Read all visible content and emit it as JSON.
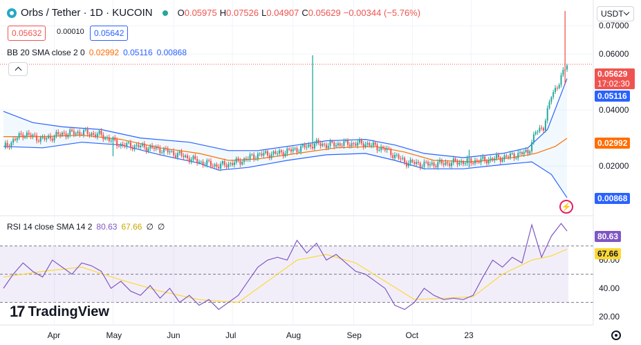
{
  "header": {
    "symbol": "Orbs / Tether · 1D · KUCOIN",
    "ohlc": {
      "o_label": "O",
      "o": "0.05975",
      "h_label": "H",
      "h": "0.07526",
      "l_label": "L",
      "l": "0.04907",
      "c_label": "C",
      "c": "0.05629",
      "change": "−0.00344 (−5.76%)"
    },
    "sell_price": "0.05632",
    "spread": "0.00010",
    "buy_price": "0.05642",
    "unit": "USDT"
  },
  "bb_legend": {
    "label": "BB 20 SMA close 2 0",
    "basis": "0.02992",
    "upper": "0.05116",
    "lower": "0.00868"
  },
  "rsi_legend": {
    "label": "RSI 14 close SMA 14 2",
    "rsi": "80.63",
    "sma": "67.66",
    "v3": "∅",
    "v4": "∅"
  },
  "price_tags": {
    "close": "0.05629",
    "countdown": "17:02:30",
    "upper": "0.05116",
    "basis": "0.02992",
    "lower": "0.00868"
  },
  "rsi_tags": {
    "rsi": "80.63",
    "sma": "67.66"
  },
  "colors": {
    "up": "#26a69a",
    "down": "#ef5350",
    "band": "#2962ff",
    "basis": "#ff6d00",
    "rsi": "#7e57c2",
    "rsi_sma": "#fdd835"
  },
  "brand": {
    "name": "TradingView"
  },
  "chart_data": [
    {
      "type": "candlestick",
      "series_name": "Orbs / Tether",
      "x_ticks": [
        "Apr",
        "May",
        "Jun",
        "Jul",
        "Aug",
        "Sep",
        "Oct",
        "23"
      ],
      "y_ticks": [
        "0.07000",
        "0.06000",
        "0.04000",
        "0.02000"
      ],
      "ylim": [
        0.004,
        0.078
      ],
      "price_path": [
        {
          "day": 0,
          "v": 0.0265
        },
        {
          "day": 10,
          "v": 0.0315
        },
        {
          "day": 20,
          "v": 0.0295
        },
        {
          "day": 30,
          "v": 0.0315
        },
        {
          "day": 40,
          "v": 0.032
        },
        {
          "day": 50,
          "v": 0.031
        },
        {
          "day": 60,
          "v": 0.0275
        },
        {
          "day": 70,
          "v": 0.027
        },
        {
          "day": 80,
          "v": 0.026
        },
        {
          "day": 90,
          "v": 0.024
        },
        {
          "day": 100,
          "v": 0.0215
        },
        {
          "day": 110,
          "v": 0.02
        },
        {
          "day": 120,
          "v": 0.0215
        },
        {
          "day": 130,
          "v": 0.024
        },
        {
          "day": 140,
          "v": 0.0245
        },
        {
          "day": 150,
          "v": 0.026
        },
        {
          "day": 160,
          "v": 0.028
        },
        {
          "day": 165,
          "v": 0.0275
        },
        {
          "day": 175,
          "v": 0.028
        },
        {
          "day": 185,
          "v": 0.028
        },
        {
          "day": 195,
          "v": 0.026
        },
        {
          "day": 205,
          "v": 0.0215
        },
        {
          "day": 215,
          "v": 0.0205
        },
        {
          "day": 225,
          "v": 0.021
        },
        {
          "day": 235,
          "v": 0.0215
        },
        {
          "day": 245,
          "v": 0.022
        },
        {
          "day": 255,
          "v": 0.023
        },
        {
          "day": 262,
          "v": 0.024
        },
        {
          "day": 268,
          "v": 0.025
        },
        {
          "day": 272,
          "v": 0.032
        },
        {
          "day": 276,
          "v": 0.034
        },
        {
          "day": 280,
          "v": 0.045
        },
        {
          "day": 284,
          "v": 0.05
        },
        {
          "day": 288,
          "v": 0.0563
        }
      ],
      "spikes": [
        {
          "day": 158,
          "low": 0.0275,
          "high": 0.0595
        },
        {
          "day": 56,
          "low": 0.0235,
          "high": 0.029
        },
        {
          "day": 238,
          "low": 0.0195,
          "high": 0.0258
        },
        {
          "day": 287,
          "low": 0.049,
          "high": 0.0753
        }
      ],
      "bb_upper_path": [
        {
          "day": 0,
          "v": 0.0395
        },
        {
          "day": 15,
          "v": 0.0355
        },
        {
          "day": 30,
          "v": 0.034
        },
        {
          "day": 50,
          "v": 0.033
        },
        {
          "day": 70,
          "v": 0.03
        },
        {
          "day": 95,
          "v": 0.0285
        },
        {
          "day": 115,
          "v": 0.0255
        },
        {
          "day": 130,
          "v": 0.0255
        },
        {
          "day": 150,
          "v": 0.0275
        },
        {
          "day": 165,
          "v": 0.029
        },
        {
          "day": 185,
          "v": 0.0295
        },
        {
          "day": 200,
          "v": 0.0275
        },
        {
          "day": 215,
          "v": 0.0245
        },
        {
          "day": 235,
          "v": 0.023
        },
        {
          "day": 255,
          "v": 0.0245
        },
        {
          "day": 268,
          "v": 0.0265
        },
        {
          "day": 278,
          "v": 0.033
        },
        {
          "day": 288,
          "v": 0.0512
        }
      ],
      "bb_basis_path": [
        {
          "day": 0,
          "v": 0.0305
        },
        {
          "day": 20,
          "v": 0.0305
        },
        {
          "day": 40,
          "v": 0.031
        },
        {
          "day": 60,
          "v": 0.0295
        },
        {
          "day": 80,
          "v": 0.0265
        },
        {
          "day": 100,
          "v": 0.0245
        },
        {
          "day": 115,
          "v": 0.022
        },
        {
          "day": 130,
          "v": 0.0225
        },
        {
          "day": 150,
          "v": 0.0245
        },
        {
          "day": 170,
          "v": 0.0265
        },
        {
          "day": 190,
          "v": 0.027
        },
        {
          "day": 205,
          "v": 0.025
        },
        {
          "day": 220,
          "v": 0.022
        },
        {
          "day": 240,
          "v": 0.0215
        },
        {
          "day": 260,
          "v": 0.023
        },
        {
          "day": 272,
          "v": 0.0245
        },
        {
          "day": 282,
          "v": 0.027
        },
        {
          "day": 288,
          "v": 0.0299
        }
      ],
      "bb_lower_path": [
        {
          "day": 0,
          "v": 0.027
        },
        {
          "day": 20,
          "v": 0.0265
        },
        {
          "day": 40,
          "v": 0.0285
        },
        {
          "day": 60,
          "v": 0.0275
        },
        {
          "day": 80,
          "v": 0.024
        },
        {
          "day": 100,
          "v": 0.021
        },
        {
          "day": 110,
          "v": 0.0185
        },
        {
          "day": 125,
          "v": 0.0195
        },
        {
          "day": 145,
          "v": 0.022
        },
        {
          "day": 165,
          "v": 0.024
        },
        {
          "day": 185,
          "v": 0.0245
        },
        {
          "day": 200,
          "v": 0.022
        },
        {
          "day": 215,
          "v": 0.019
        },
        {
          "day": 235,
          "v": 0.019
        },
        {
          "day": 255,
          "v": 0.0205
        },
        {
          "day": 270,
          "v": 0.0215
        },
        {
          "day": 280,
          "v": 0.017
        },
        {
          "day": 288,
          "v": 0.0087
        }
      ]
    },
    {
      "type": "line",
      "series_name": "RSI 14",
      "y_ticks": [
        "60.00",
        "40.00",
        "20.00"
      ],
      "ylim": [
        15,
        90
      ],
      "bands": [
        70,
        50,
        30
      ],
      "rsi_path": [
        {
          "day": 0,
          "v": 40
        },
        {
          "day": 5,
          "v": 50
        },
        {
          "day": 10,
          "v": 58
        },
        {
          "day": 15,
          "v": 52
        },
        {
          "day": 20,
          "v": 48
        },
        {
          "day": 25,
          "v": 60
        },
        {
          "day": 30,
          "v": 55
        },
        {
          "day": 35,
          "v": 50
        },
        {
          "day": 40,
          "v": 58
        },
        {
          "day": 45,
          "v": 56
        },
        {
          "day": 50,
          "v": 52
        },
        {
          "day": 55,
          "v": 40
        },
        {
          "day": 60,
          "v": 45
        },
        {
          "day": 65,
          "v": 38
        },
        {
          "day": 70,
          "v": 35
        },
        {
          "day": 75,
          "v": 42
        },
        {
          "day": 80,
          "v": 33
        },
        {
          "day": 85,
          "v": 40
        },
        {
          "day": 90,
          "v": 30
        },
        {
          "day": 95,
          "v": 35
        },
        {
          "day": 100,
          "v": 28
        },
        {
          "day": 105,
          "v": 32
        },
        {
          "day": 110,
          "v": 25
        },
        {
          "day": 115,
          "v": 30
        },
        {
          "day": 120,
          "v": 35
        },
        {
          "day": 125,
          "v": 45
        },
        {
          "day": 130,
          "v": 55
        },
        {
          "day": 135,
          "v": 60
        },
        {
          "day": 140,
          "v": 62
        },
        {
          "day": 145,
          "v": 60
        },
        {
          "day": 150,
          "v": 74
        },
        {
          "day": 155,
          "v": 65
        },
        {
          "day": 160,
          "v": 72
        },
        {
          "day": 165,
          "v": 60
        },
        {
          "day": 170,
          "v": 64
        },
        {
          "day": 175,
          "v": 58
        },
        {
          "day": 180,
          "v": 52
        },
        {
          "day": 185,
          "v": 50
        },
        {
          "day": 190,
          "v": 45
        },
        {
          "day": 195,
          "v": 40
        },
        {
          "day": 200,
          "v": 28
        },
        {
          "day": 205,
          "v": 25
        },
        {
          "day": 210,
          "v": 30
        },
        {
          "day": 215,
          "v": 40
        },
        {
          "day": 220,
          "v": 35
        },
        {
          "day": 225,
          "v": 32
        },
        {
          "day": 230,
          "v": 33
        },
        {
          "day": 235,
          "v": 32
        },
        {
          "day": 240,
          "v": 35
        },
        {
          "day": 245,
          "v": 48
        },
        {
          "day": 250,
          "v": 60
        },
        {
          "day": 255,
          "v": 55
        },
        {
          "day": 260,
          "v": 62
        },
        {
          "day": 265,
          "v": 58
        },
        {
          "day": 270,
          "v": 85
        },
        {
          "day": 275,
          "v": 62
        },
        {
          "day": 280,
          "v": 77
        },
        {
          "day": 285,
          "v": 86
        },
        {
          "day": 288,
          "v": 80.6
        }
      ],
      "sma_path": [
        {
          "day": 0,
          "v": 48
        },
        {
          "day": 20,
          "v": 52
        },
        {
          "day": 40,
          "v": 55
        },
        {
          "day": 60,
          "v": 46
        },
        {
          "day": 80,
          "v": 38
        },
        {
          "day": 100,
          "v": 32
        },
        {
          "day": 120,
          "v": 30
        },
        {
          "day": 135,
          "v": 45
        },
        {
          "day": 150,
          "v": 60
        },
        {
          "day": 165,
          "v": 64
        },
        {
          "day": 180,
          "v": 58
        },
        {
          "day": 195,
          "v": 45
        },
        {
          "day": 210,
          "v": 32
        },
        {
          "day": 225,
          "v": 33
        },
        {
          "day": 240,
          "v": 34
        },
        {
          "day": 255,
          "v": 50
        },
        {
          "day": 270,
          "v": 60
        },
        {
          "day": 280,
          "v": 63
        },
        {
          "day": 288,
          "v": 67.7
        }
      ]
    }
  ]
}
